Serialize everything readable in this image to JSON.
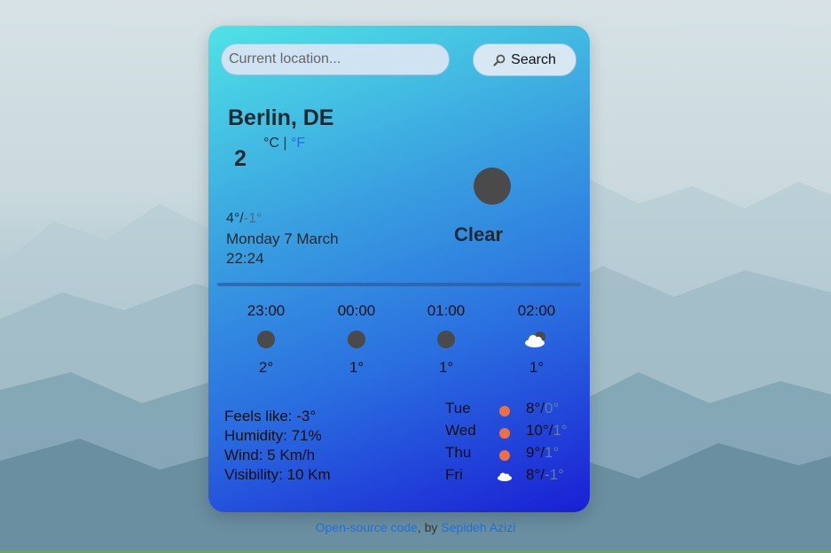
{
  "search": {
    "placeholder": "Current location...",
    "button_label": "Search"
  },
  "current": {
    "city": "Berlin, DE",
    "temp": "2",
    "unit_c": "°C",
    "unit_sep": " | ",
    "unit_f": "°F",
    "hi": "4°/",
    "lo": "-1°",
    "date": "Monday 7 March",
    "time": "22:24",
    "description": "Clear",
    "icon": "moon-icon"
  },
  "hourly": [
    {
      "time": "23:00",
      "temp": "2°",
      "icon": "moon-icon"
    },
    {
      "time": "00:00",
      "temp": "1°",
      "icon": "moon-icon"
    },
    {
      "time": "01:00",
      "temp": "1°",
      "icon": "moon-icon"
    },
    {
      "time": "02:00",
      "temp": "1°",
      "icon": "cloud-night-icon"
    }
  ],
  "details": {
    "feels_like": "Feels like: -3°",
    "humidity": "Humidity: 71%",
    "wind": "Wind: 5 Km/h",
    "visibility": "Visibility: 10 Km"
  },
  "forecast": [
    {
      "day": "Tue",
      "hi": "8°/",
      "lo": "0°",
      "icon": "sun-icon"
    },
    {
      "day": "Wed",
      "hi": "10°/",
      "lo": "1°",
      "icon": "sun-icon"
    },
    {
      "day": "Thu",
      "hi": "9°/",
      "lo": "1°",
      "icon": "sun-icon"
    },
    {
      "day": "Fri",
      "hi": "8°/",
      "lo": "-1°",
      "icon": "cloud-icon"
    }
  ],
  "footer": {
    "link1": "Open-source code",
    "sep": ", by ",
    "link2": "Sepideh Azizi"
  },
  "colors": {
    "accent": "#1f6ee0",
    "sun": "#ee7040",
    "moon": "#4a4a4a"
  }
}
